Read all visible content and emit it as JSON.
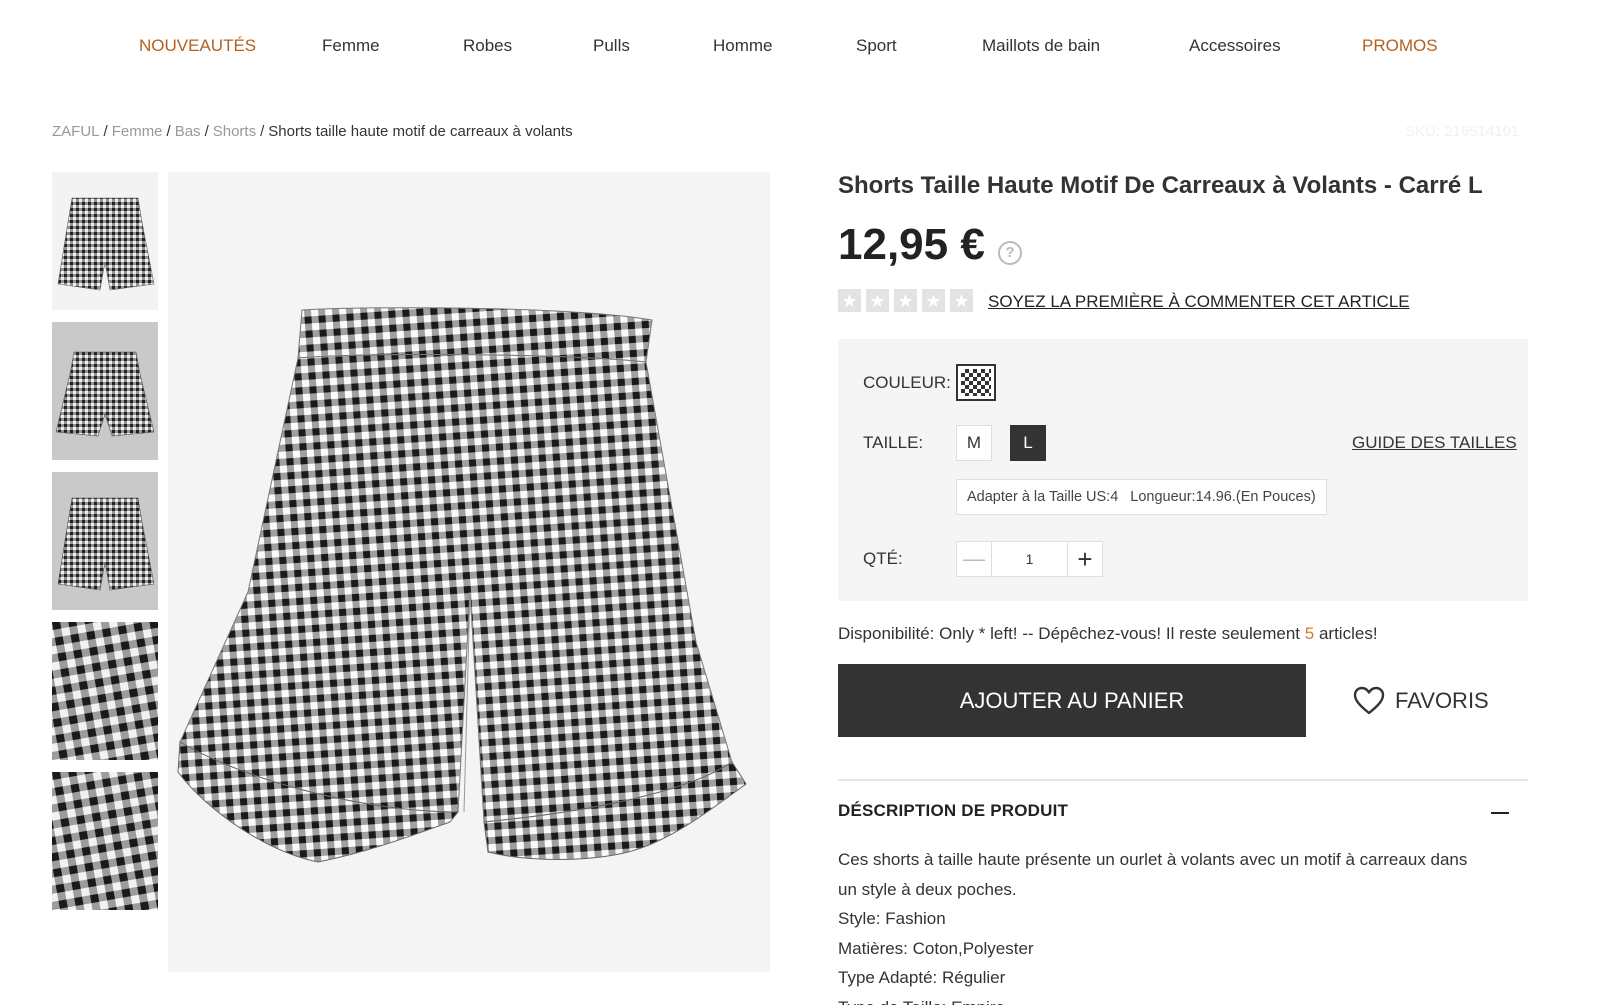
{
  "nav": {
    "items": [
      {
        "label": "NOUVEAUTÉS",
        "highlight": true
      },
      {
        "label": "Femme",
        "highlight": false
      },
      {
        "label": "Robes",
        "highlight": false
      },
      {
        "label": "Pulls",
        "highlight": false
      },
      {
        "label": "Homme",
        "highlight": false
      },
      {
        "label": "Sport",
        "highlight": false
      },
      {
        "label": "Maillots de bain",
        "highlight": false
      },
      {
        "label": "Accessoires",
        "highlight": false
      },
      {
        "label": "PROMOS",
        "highlight": true
      }
    ],
    "highlight_color": "#b5601f"
  },
  "breadcrumb": {
    "items": [
      "ZAFUL",
      "Femme",
      "Bas",
      "Shorts"
    ],
    "current": "Shorts taille haute motif de carreaux à volants"
  },
  "sku": "SKU: 216514101",
  "gallery": {
    "thumbnails": [
      {
        "icon": "shorts-front-thumbnail"
      },
      {
        "icon": "shorts-back-thumbnail"
      },
      {
        "icon": "shorts-flat-thumbnail"
      },
      {
        "icon": "waistband-detail-thumbnail"
      },
      {
        "icon": "ruffle-hem-detail-thumbnail"
      }
    ],
    "main_image": "gingham-shorts-main-image"
  },
  "product": {
    "title": "Shorts Taille Haute Motif De Carreaux à Volants - Carré L",
    "price": "12,95 €",
    "price_help_icon": "?",
    "rating_stars": 0,
    "review_link": "SOYEZ LA PREMIÈRE À COMMENTER CET ARTICLE"
  },
  "options": {
    "color_label": "COULEUR:",
    "color_swatch": "gingham-checkered-swatch",
    "size_label": "TAILLE:",
    "sizes": [
      {
        "label": "M",
        "selected": false
      },
      {
        "label": "L",
        "selected": true
      }
    ],
    "size_guide": "GUIDE DES TAILLES",
    "fit_note_1": "Adapter à la Taille US:4",
    "fit_note_2": "Longueur:14.96.(En Pouces)",
    "qty_label": "QTÉ:",
    "qty_value": "1",
    "qty_minus": "—",
    "qty_plus": "+"
  },
  "availability": {
    "prefix": "Disponibilité: Only * left! -- Dépêchez-vous! Il reste seulement",
    "count": "5",
    "suffix": "articles!"
  },
  "actions": {
    "add_to_cart": "AJOUTER AU PANIER",
    "favorites": "FAVORIS"
  },
  "description": {
    "heading": "DÉSCRIPTION DE PRODUIT",
    "lines": [
      "Ces shorts à taille haute présente un ourlet à volants avec un motif à carreaux dans",
      "un style à deux poches.",
      "Style: Fashion",
      "Matières: Coton,Polyester",
      "Type Adapté: Régulier",
      "Type de Taille: Empire"
    ]
  },
  "colors": {
    "text": "#333333",
    "button_dark": "#333333",
    "accent_orange": "#c9822e",
    "panel_bg": "#f5f5f5"
  }
}
